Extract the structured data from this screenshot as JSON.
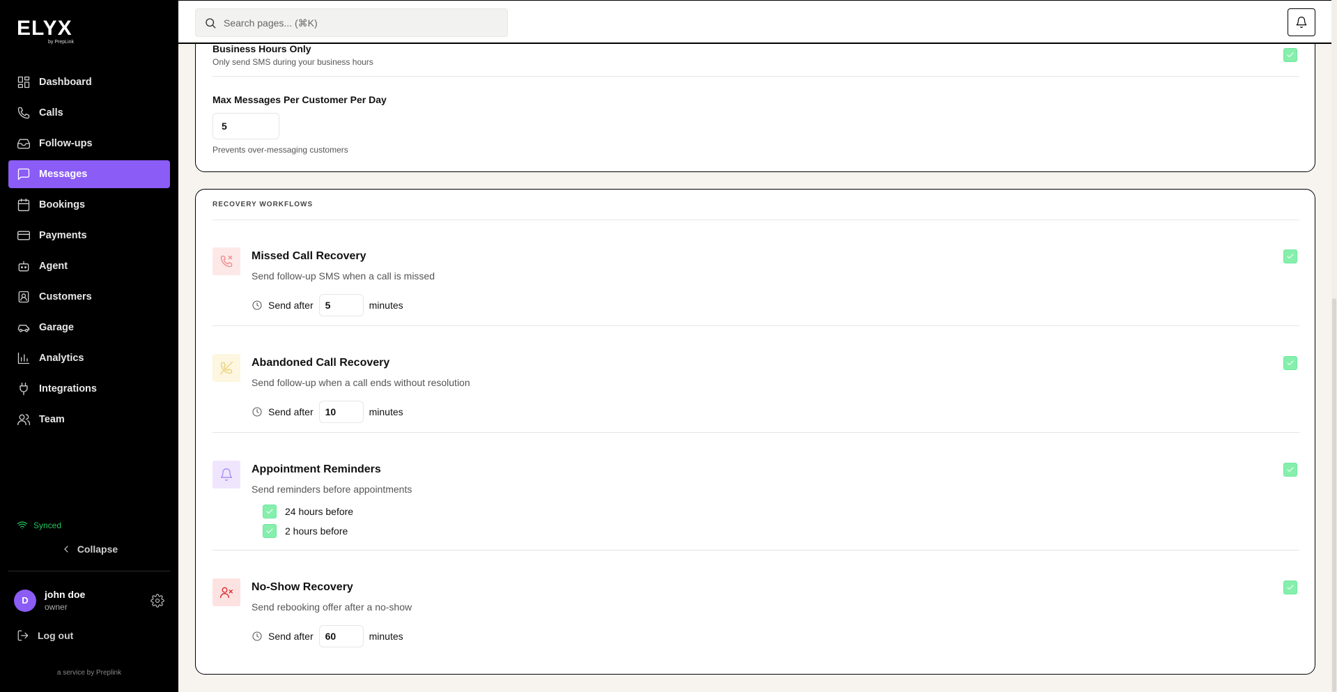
{
  "brand": {
    "logo": "ELYX",
    "sub": "by PrepLink"
  },
  "nav": [
    {
      "label": "Dashboard",
      "icon": "dashboard-icon"
    },
    {
      "label": "Calls",
      "icon": "phone-icon"
    },
    {
      "label": "Follow-ups",
      "icon": "inbox-icon"
    },
    {
      "label": "Messages",
      "icon": "message-icon",
      "active": true
    },
    {
      "label": "Bookings",
      "icon": "calendar-icon"
    },
    {
      "label": "Payments",
      "icon": "card-icon"
    },
    {
      "label": "Agent",
      "icon": "bot-icon"
    },
    {
      "label": "Customers",
      "icon": "contact-icon"
    },
    {
      "label": "Garage",
      "icon": "car-icon"
    },
    {
      "label": "Analytics",
      "icon": "chart-icon"
    },
    {
      "label": "Integrations",
      "icon": "plug-icon"
    },
    {
      "label": "Team",
      "icon": "users-icon"
    }
  ],
  "status": {
    "synced": "Synced"
  },
  "collapse_label": "Collapse",
  "user": {
    "initial": "D",
    "name": "john doe",
    "role": "owner"
  },
  "logout_label": "Log out",
  "service_note": "a service by Preplink",
  "search": {
    "placeholder": "Search pages... (⌘K)"
  },
  "settings": {
    "business_hours": {
      "title": "Business Hours Only",
      "desc": "Only send SMS during your business hours",
      "checked": true
    },
    "max_messages": {
      "title": "Max Messages Per Customer Per Day",
      "value": "5",
      "hint": "Prevents over-messaging customers"
    }
  },
  "recovery": {
    "section_label": "RECOVERY WORKFLOWS",
    "send_after_label": "Send after",
    "minutes_label": "minutes",
    "workflows": [
      {
        "title": "Missed Call Recovery",
        "desc": "Send follow-up SMS when a call is missed",
        "value": "5",
        "icon": "phone-missed-icon",
        "checked": true
      },
      {
        "title": "Abandoned Call Recovery",
        "desc": "Send follow-up when a call ends without resolution",
        "value": "10",
        "icon": "phone-off-icon",
        "checked": true
      },
      {
        "title": "Appointment Reminders",
        "desc": "Send reminders before appointments",
        "icon": "bell-icon",
        "checked": true,
        "reminders": [
          {
            "label": "24 hours before",
            "checked": true
          },
          {
            "label": "2 hours before",
            "checked": true
          }
        ]
      },
      {
        "title": "No-Show Recovery",
        "desc": "Send rebooking offer after a no-show",
        "value": "60",
        "icon": "user-x-icon",
        "checked": true
      }
    ]
  },
  "colors": {
    "accent": "#8b5cf6",
    "sidebar": "#000000",
    "check": "#86efac",
    "synced": "#22c55e"
  }
}
